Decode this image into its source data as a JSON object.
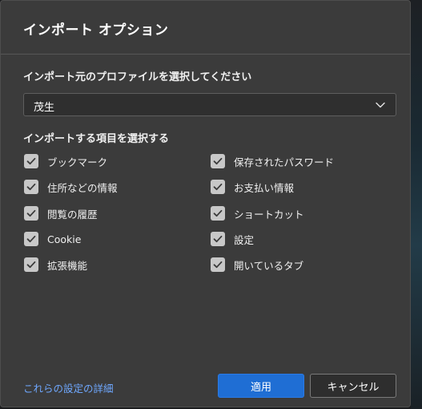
{
  "dialog": {
    "title": "インポート オプション"
  },
  "profile": {
    "label": "インポート元のプロファイルを選択してください",
    "selected": "茂生"
  },
  "items_section": {
    "label": "インポートする項目を選択する",
    "left": [
      {
        "label": "ブックマーク",
        "checked": true
      },
      {
        "label": "住所などの情報",
        "checked": true
      },
      {
        "label": "閲覧の履歴",
        "checked": true
      },
      {
        "label": "Cookie",
        "checked": true
      },
      {
        "label": "拡張機能",
        "checked": true
      }
    ],
    "right": [
      {
        "label": "保存されたパスワード",
        "checked": true
      },
      {
        "label": "お支払い情報",
        "checked": true
      },
      {
        "label": "ショートカット",
        "checked": true
      },
      {
        "label": "設定",
        "checked": true
      },
      {
        "label": "開いているタブ",
        "checked": true
      }
    ]
  },
  "footer": {
    "details_link": "これらの設定の詳細",
    "import_button": "適用",
    "cancel_button": "キャンセル"
  },
  "colors": {
    "accent": "#1f6ed4",
    "link": "#6fa8ff",
    "dialog_bg": "#3b3b3b"
  }
}
